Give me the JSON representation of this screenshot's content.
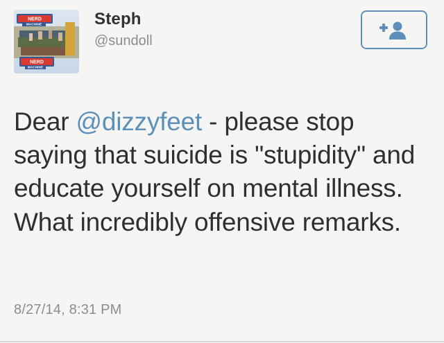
{
  "tweet": {
    "author": {
      "display_name": "Steph",
      "username": "@sundoll",
      "avatar_text": "NERD MACHINE"
    },
    "follow_icon": "add-user-icon",
    "text_before": "Dear ",
    "mention": "@dizzyfeet",
    "text_after": " - please stop saying that suicide is \"stupidity\" and educate yourself on mental illness. What incredibly offensive remarks.",
    "timestamp": "8/27/14, 8:31 PM"
  },
  "theme": {
    "background": "#f5f6f3",
    "accent": "#5d8fbb",
    "text": "#2f2f2f",
    "muted": "#8a8d8f",
    "divider": "#d3d6d2"
  }
}
